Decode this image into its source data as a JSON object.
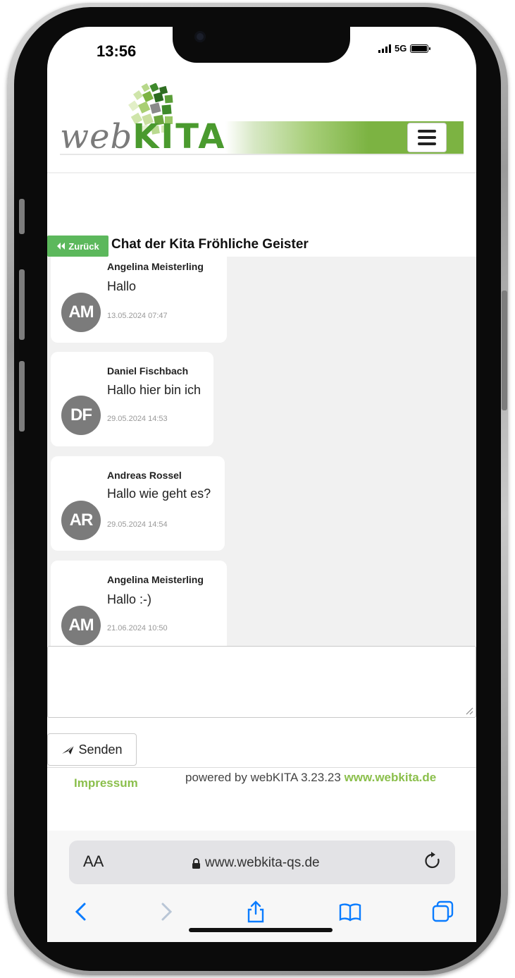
{
  "status": {
    "time": "13:56",
    "network": "5G"
  },
  "brand": {
    "logo_prefix": "web",
    "logo_suffix": "KITA"
  },
  "nav": {
    "back_label": "Zurück"
  },
  "chat": {
    "title": "Chat der Kita Fröhliche Geister",
    "messages": [
      {
        "initials": "AM",
        "name": "Angelina Meisterling",
        "text": "Hallo",
        "time": "13.05.2024 07:47"
      },
      {
        "initials": "DF",
        "name": "Daniel Fischbach",
        "text": "Hallo hier bin ich",
        "time": "29.05.2024 14:53"
      },
      {
        "initials": "AR",
        "name": "Andreas Rossel",
        "text": "Hallo wie geht es?",
        "time": "29.05.2024 14:54"
      },
      {
        "initials": "AM",
        "name": "Angelina Meisterling",
        "text": "Hallo :-)",
        "time": "21.06.2024 10:50"
      }
    ]
  },
  "compose": {
    "value": "",
    "send_label": "Senden"
  },
  "footer": {
    "impressum": "Impressum",
    "powered_text": "powered by webKITA 3.23.23",
    "powered_link": "www.webkita.de"
  },
  "browser": {
    "text_size_label": "AA",
    "url": "www.webkita-qs.de"
  },
  "colors": {
    "accent_green": "#7cb342",
    "avatar_gray": "#7b7b7b",
    "back_button": "#5cb85c"
  }
}
